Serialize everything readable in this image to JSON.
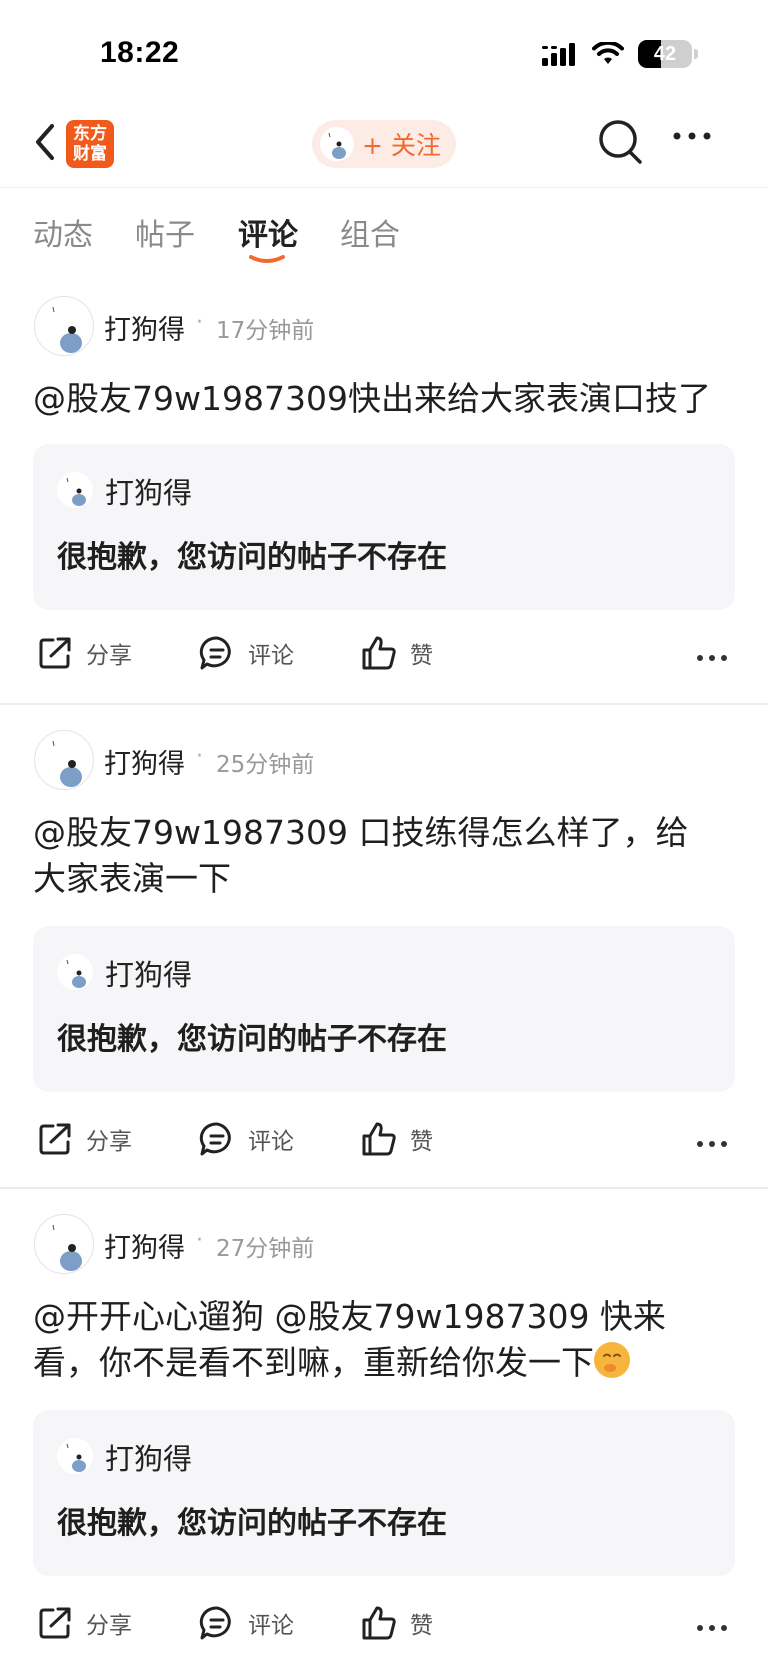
{
  "status": {
    "time": "18:22",
    "battery": "42",
    "battery_level": 0.42
  },
  "header": {
    "logo_line1": "东方",
    "logo_line2": "财富",
    "follow_label": "+ 关注"
  },
  "tabs": [
    {
      "label": "动态"
    },
    {
      "label": "帖子"
    },
    {
      "label": "评论"
    },
    {
      "label": "组合"
    }
  ],
  "active_tab": "评论",
  "posts": [
    {
      "author": "打狗得",
      "time_ago": "17分钟前",
      "text": "@股友79w1987309快出来给大家表演口技了",
      "quote_author": "打狗得",
      "quote_text": "很抱歉，您访问的帖子不存在"
    },
    {
      "author": "打狗得",
      "time_ago": "25分钟前",
      "text_line1": "@股友79w1987309 口技练得怎么样了，给",
      "text_line2": "大家表演一下",
      "quote_author": "打狗得",
      "quote_text": "很抱歉，您访问的帖子不存在"
    },
    {
      "author": "打狗得",
      "time_ago": "27分钟前",
      "text_line1": "@开开心心遛狗 @股友79w1987309 快来",
      "text_line2": "看，你不是看不到嘛，重新给你发一下",
      "quote_author": "打狗得",
      "quote_text": "很抱歉，您访问的帖子不存在"
    }
  ],
  "actions": {
    "share": "分享",
    "comment": "评论",
    "like": "赞"
  },
  "separator": "·",
  "colors": {
    "accent": "#f26a2e",
    "logo_bg": "#f25a1c",
    "quote_bg": "#f6f6f8"
  }
}
